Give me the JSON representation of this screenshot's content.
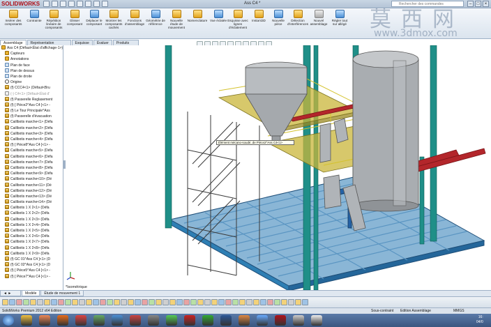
{
  "app": {
    "logo_text": "SOLIDWORKS",
    "document_title": "Ass C4 *",
    "search_placeholder": "Rechercher des commandes"
  },
  "ribbon": {
    "buttons": [
      {
        "label": "Insérer des composants",
        "icon": "insert-component-icon"
      },
      {
        "label": "Contrainte",
        "icon": "mate-icon"
      },
      {
        "label": "Répétition linéaire de composants",
        "icon": "linear-pattern-icon"
      },
      {
        "label": "Glisser composant",
        "icon": "move-icon"
      },
      {
        "label": "Déplacer le composant",
        "icon": "move-component-icon"
      },
      {
        "label": "Montrer les composants cachés",
        "icon": "show-hidden-icon"
      },
      {
        "label": "Fonctions d'assemblage",
        "icon": "assembly-features-icon"
      },
      {
        "label": "Géométrie de référence",
        "icon": "reference-geometry-icon"
      },
      {
        "label": "Nouvelle étude de mouvement",
        "icon": "motion-study-icon"
      },
      {
        "label": "Nomenclature",
        "icon": "bom-icon"
      },
      {
        "label": "Vue éclatée",
        "icon": "exploded-view-icon"
      },
      {
        "label": "Esquisse avec lignes d'éclatement",
        "icon": "explode-line-icon"
      },
      {
        "label": "Instant3D",
        "icon": "instant3d-icon"
      },
      {
        "label": "Nouvelle pièce",
        "icon": "new-part-icon"
      },
      {
        "label": "Détection d'interférences",
        "icon": "interference-icon"
      },
      {
        "label": "Nouvel assemblage",
        "icon": "new-assembly-icon"
      },
      {
        "label": "Régler tout sur allégé",
        "icon": "lightweight-icon"
      }
    ]
  },
  "command_tabs": [
    "Assemblage",
    "Représentation schématique",
    "Esquisse",
    "Évaluer",
    "Produits Office"
  ],
  "feature_tree": {
    "items": [
      {
        "label": "Ass C4  (Défaut<État d'affichage-1>)",
        "indent": 1,
        "icon": "assembly"
      },
      {
        "label": "Capteurs",
        "indent": 2,
        "icon": "folder"
      },
      {
        "label": "Annotations",
        "indent": 2,
        "icon": "folder"
      },
      {
        "label": "Plan de face",
        "indent": 2,
        "icon": "plane"
      },
      {
        "label": "Plan de dessus",
        "indent": 2,
        "icon": "plane"
      },
      {
        "label": "Plan de droite",
        "indent": 2,
        "icon": "plane"
      },
      {
        "label": "Origine",
        "indent": 2,
        "icon": "origin"
      },
      {
        "label": "(f) CCC4<1> (Défaut<Bru",
        "indent": 2,
        "icon": "part"
      },
      {
        "label": "(-) C4<1> (Défaut<État d'",
        "indent": 2,
        "icon": "doc"
      },
      {
        "label": "(f) Passerelle Reglasement",
        "indent": 2,
        "icon": "part"
      },
      {
        "label": "(f) [ Pièce2^Ass C4 ]<1> -",
        "indent": 2,
        "icon": "part"
      },
      {
        "label": "(f) Le Tour Principale^Ass",
        "indent": 2,
        "icon": "part"
      },
      {
        "label": "(f) Passerelle d'évacuation",
        "indent": 2,
        "icon": "part"
      },
      {
        "label": "Caillbotis marche<1> (Défa",
        "indent": 2,
        "icon": "part"
      },
      {
        "label": "Caillbotis marche<2> (Défa",
        "indent": 2,
        "icon": "part"
      },
      {
        "label": "Caillbotis marche<3> (Défa",
        "indent": 2,
        "icon": "part"
      },
      {
        "label": "Caillbotis marche<4> (Défa",
        "indent": 2,
        "icon": "part"
      },
      {
        "label": "(f) [ Pièce8^Ass C4 ]<1> -",
        "indent": 2,
        "icon": "part"
      },
      {
        "label": "Caillbotis marche<5> (Défa",
        "indent": 2,
        "icon": "part"
      },
      {
        "label": "Caillbotis marche<6> (Défa",
        "indent": 2,
        "icon": "part"
      },
      {
        "label": "Caillbotis marche<7> (Défa",
        "indent": 2,
        "icon": "part"
      },
      {
        "label": "Caillbotis marche<8> (Défa",
        "indent": 2,
        "icon": "part"
      },
      {
        "label": "Caillbotis marche<9> (Défa",
        "indent": 2,
        "icon": "part"
      },
      {
        "label": "Caillbotis marche<10> (Dé",
        "indent": 2,
        "icon": "part"
      },
      {
        "label": "Caillbotis marche<11> (Dé",
        "indent": 2,
        "icon": "part"
      },
      {
        "label": "Caillbotis marche<12> (Dé",
        "indent": 2,
        "icon": "part"
      },
      {
        "label": "Caillbotis marche<13> (Dé",
        "indent": 2,
        "icon": "part"
      },
      {
        "label": "Caillbotis marche<14> (Dé",
        "indent": 2,
        "icon": "part"
      },
      {
        "label": "Caillbotis 1 X 2<1> (Défa",
        "indent": 2,
        "icon": "part"
      },
      {
        "label": "Caillbotis 1 X 2<2> (Défa",
        "indent": 2,
        "icon": "part"
      },
      {
        "label": "Caillbotis 1 X 2<3> (Défa",
        "indent": 2,
        "icon": "part"
      },
      {
        "label": "Caillbotis 1 X 2<4> (Défa",
        "indent": 2,
        "icon": "part"
      },
      {
        "label": "Caillbotis 1 X 2<5> (Défa",
        "indent": 2,
        "icon": "part"
      },
      {
        "label": "Caillbotis 1 X 2<6> (Défa",
        "indent": 2,
        "icon": "part"
      },
      {
        "label": "Caillbotis 1 X 2<7> (Défa",
        "indent": 2,
        "icon": "part"
      },
      {
        "label": "Caillbotis 1 X 2<8> (Défa",
        "indent": 2,
        "icon": "part"
      },
      {
        "label": "Caillbotis 1 X 2<9> (Défa",
        "indent": 2,
        "icon": "part"
      },
      {
        "label": "(f) GC 01^Ass C4 ]<1> (D",
        "indent": 2,
        "icon": "part"
      },
      {
        "label": "(f) GC 02^Ass C4 ]<1> (D",
        "indent": 2,
        "icon": "part"
      },
      {
        "label": "(f) [ Pièce5^Ass C4 ]<1> -",
        "indent": 2,
        "icon": "part"
      },
      {
        "label": "(f) [ Pièce7^Ass C4 ]<1> -",
        "indent": 2,
        "icon": "part"
      }
    ]
  },
  "viewport": {
    "tooltip": "Élément mécano-soudé, de Pièce2^Ass C4<1>",
    "view_label": "*Isométrique"
  },
  "bottom_tabs": [
    "Modèle",
    "Étude de mouvement 1"
  ],
  "status_bar": {
    "left": "SolidWorks Premium 2012 x64 Edition",
    "middle": "Sous-contraint",
    "mode": "Edition Assemblage",
    "units": "MMGS"
  },
  "taskbar": {
    "time": "16:",
    "date": "04/0"
  },
  "watermark": {
    "chinese": "莫西网",
    "url": "www.3dmox.com"
  },
  "colors": {
    "structure_teal": "#1f8f88",
    "base_blue": "#2e7fb4",
    "accent_red": "#b3262b",
    "platform_yellow": "#c9b53a",
    "tank_grey": "#a5a9ad"
  }
}
